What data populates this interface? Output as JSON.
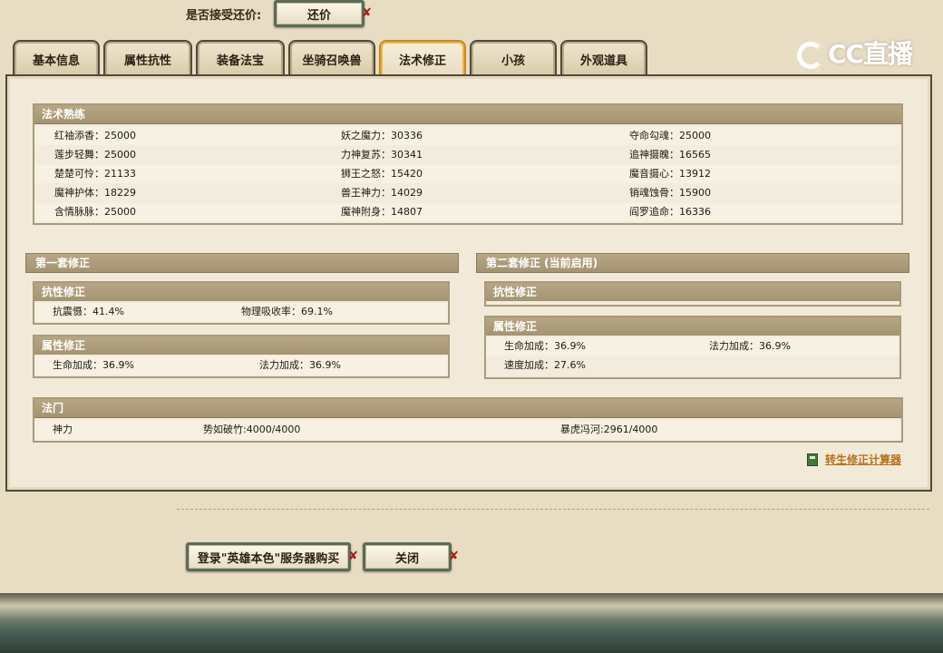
{
  "top": {
    "accept_label": "是否接受还价:",
    "counter_button": "还价"
  },
  "tabs": [
    "基本信息",
    "属性抗性",
    "装备法宝",
    "坐骑召唤兽",
    "法术修正",
    "小孩",
    "外观道具"
  ],
  "active_tab_index": 4,
  "logo": "CC直播",
  "skill": {
    "header": "法术熟练",
    "rows": [
      [
        "红袖添香：25000",
        "妖之魔力：30336",
        "夺命勾魂：25000"
      ],
      [
        "莲步轻舞：25000",
        "力神复苏：30341",
        "追神摄魄：16565"
      ],
      [
        "楚楚可怜：21133",
        "狮王之怒：15420",
        "魔音摄心：13912"
      ],
      [
        "魔神护体：18229",
        "兽王神力：14029",
        "销魂蚀骨：15900"
      ],
      [
        "含情脉脉：25000",
        "魔神附身：14807",
        "阎罗追命：16336"
      ]
    ]
  },
  "set1": {
    "header": "第一套修正",
    "resist_header": "抗性修正",
    "resist": [
      "抗震慑：41.4%",
      "物理吸收率：69.1%"
    ],
    "attr_header": "属性修正",
    "attr": [
      "生命加成：36.9%",
      "法力加成：36.9%"
    ]
  },
  "set2": {
    "header": "第二套修正 (当前启用)",
    "resist_header": "抗性修正",
    "attr_header": "属性修正",
    "attr_row1": [
      "生命加成：36.9%",
      "法力加成：36.9%"
    ],
    "attr_row2": "速度加成：27.6%"
  },
  "fa": {
    "header": "法门",
    "row": [
      "神力",
      "势如破竹:4000/4000",
      "暴虎冯河:2961/4000"
    ]
  },
  "calc_link": "转生修正计算器",
  "bottom": {
    "login_button": "登录\"英雄本色\"服务器购买",
    "close_button": "关闭"
  }
}
